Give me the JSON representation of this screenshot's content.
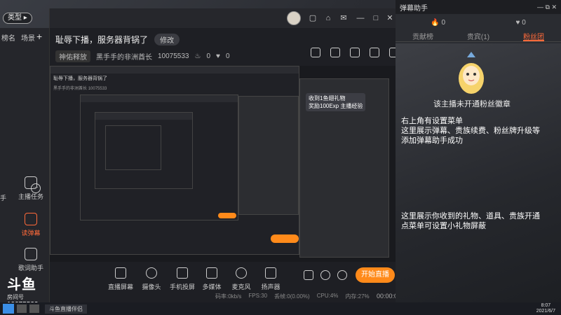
{
  "type_tag": "类型",
  "left_sidebar": {
    "tabs": [
      "榜名",
      "场景"
    ],
    "plus": "+",
    "items": [
      {
        "label": "主播任务",
        "icon": "task-icon"
      },
      {
        "label": "读弹幕",
        "icon": "danmaku-icon",
        "active": true
      },
      {
        "label": "歌词助手",
        "icon": "lyrics-icon"
      }
    ],
    "more": "···",
    "cut_label": "手"
  },
  "logo": {
    "text": "斗鱼",
    "room_label": "房间号",
    "room_number": "10075533"
  },
  "window": {
    "title": "耻辱下播，服务器背锅了",
    "edit_label": "修改",
    "category": "神佑释放",
    "streamer": "黑手手的非洲酋长",
    "room_id": "10075533",
    "heat": "0",
    "likes": "0",
    "controls": [
      "—",
      "□",
      "✕"
    ]
  },
  "preview": {
    "gift_header": "收到1鱼翅礼物",
    "gift_reward": "奖励100Exp 主播经验",
    "nested_title": "耻辱下播，服务器背锅了",
    "nested_streamer": "黑手手的非洲酋长",
    "nested_room": "10075533"
  },
  "toolbar": {
    "tools": [
      {
        "label": "直播屏幕",
        "icon": "screen-icon"
      },
      {
        "label": "摄像头",
        "icon": "camera-icon"
      },
      {
        "label": "手机投屏",
        "icon": "phone-cast-icon"
      },
      {
        "label": "多媒体",
        "icon": "media-icon"
      },
      {
        "label": "麦克风",
        "icon": "mic-icon"
      },
      {
        "label": "扬声器",
        "icon": "speaker-icon"
      }
    ],
    "start_label": "开始直播",
    "status": {
      "bitrate": "码率:0kb/s",
      "fps": "FPS:30",
      "drop": "丢帧:0(0.00%)",
      "cpu": "CPU:4%",
      "mem": "内存:27%"
    },
    "timer": "00:00:00"
  },
  "right_panel": {
    "title": "弹幕助手",
    "stats": [
      {
        "icon": "fire-icon",
        "value": "0"
      },
      {
        "icon": "heart-icon",
        "value": "0"
      }
    ],
    "tabs": [
      "贡献榜",
      "贵宾(1)",
      "粉丝团"
    ],
    "active_tab": 2,
    "no_fans_text": "该主播未开通粉丝徽章",
    "messages": [
      "右上角有设置菜单",
      "这里展示弹幕、贵族续费、粉丝牌升级等",
      "添加弹幕助手成功",
      "这里展示你收到的礼物、道具、贵族开通",
      "点菜单可设置小礼物屏蔽"
    ]
  },
  "taskbar": {
    "app_label": "斗鱼直播伴侣",
    "time": "8:07",
    "date": "2021/6/7"
  }
}
